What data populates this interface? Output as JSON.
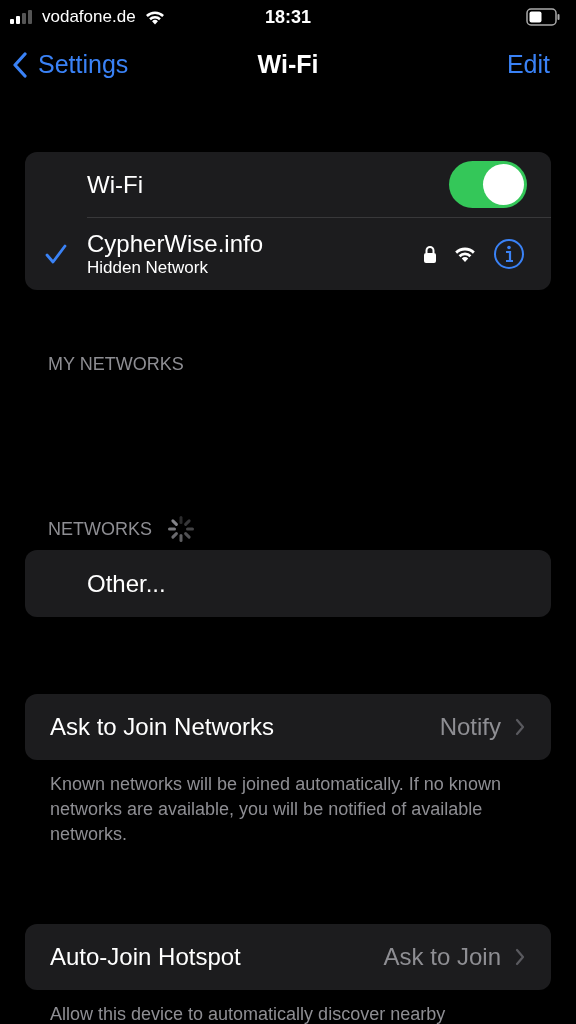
{
  "status_bar": {
    "carrier": "vodafone.de",
    "time": "18:31"
  },
  "nav": {
    "back": "Settings",
    "title": "Wi-Fi",
    "action": "Edit"
  },
  "wifi": {
    "label": "Wi-Fi",
    "on": true
  },
  "current_network": {
    "name": "CypherWise.info",
    "subtitle": "Hidden Network",
    "selected": true,
    "locked": true
  },
  "my_networks": {
    "header": "MY NETWORKS"
  },
  "networks": {
    "header": "NETWORKS",
    "loading": true,
    "items": [
      {
        "label": "Other..."
      }
    ]
  },
  "settings": [
    {
      "label": "Ask to Join Networks",
      "value": "Notify",
      "footer": "Known networks will be joined automatically. If no known networks are available, you will be notified of available networks."
    },
    {
      "label": "Auto-Join Hotspot",
      "value": "Ask to Join",
      "footer": "Allow this device to automatically discover nearby"
    }
  ]
}
